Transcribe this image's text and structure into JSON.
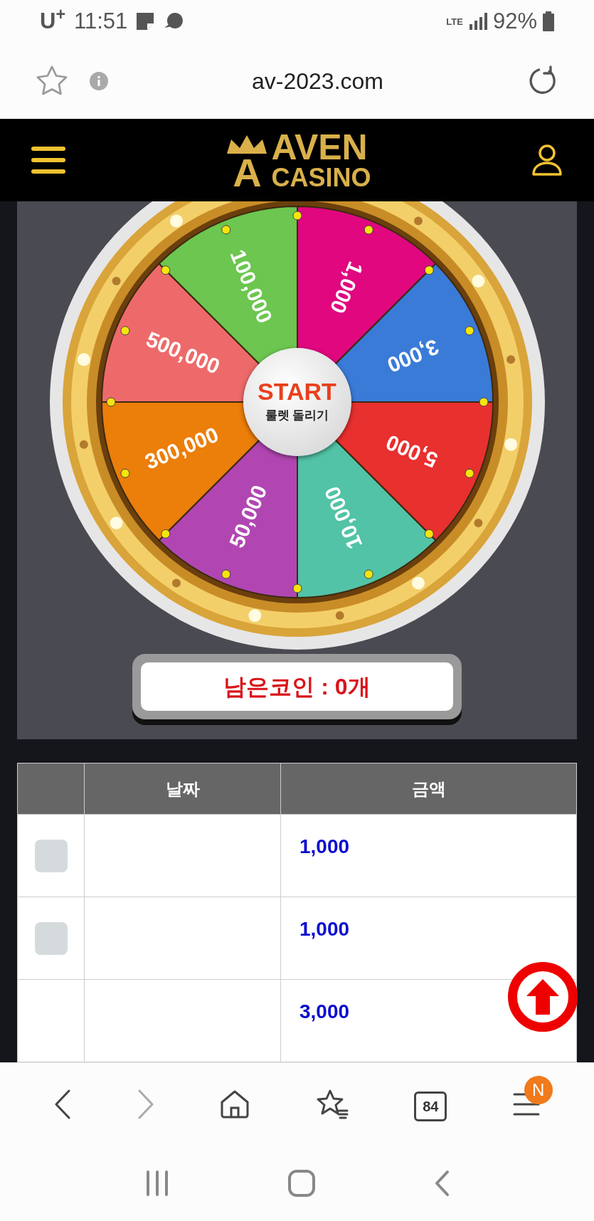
{
  "status_bar": {
    "carrier": "U$^{+}$",
    "time": "11:51",
    "network": "LTE",
    "battery": "92%"
  },
  "browser": {
    "url": "av-2023.com"
  },
  "header": {
    "logo_letter": "A",
    "logo_top": "AVEN",
    "logo_bottom": "CASINO"
  },
  "wheel": {
    "segments": [
      {
        "label": "1,000",
        "color": "#e0077f"
      },
      {
        "label": "3,000",
        "color": "#3a7bd8"
      },
      {
        "label": "5,000",
        "color": "#e8302f"
      },
      {
        "label": "10,000",
        "color": "#52c3a6"
      },
      {
        "label": "50,000",
        "color": "#b146b3"
      },
      {
        "label": "300,000",
        "color": "#ec7e0a"
      },
      {
        "label": "500,000",
        "color": "#ee6a6a"
      },
      {
        "label": "100,000",
        "color": "#6cc64f"
      }
    ],
    "start_label": "START",
    "start_sublabel": "룰렛 돌리기"
  },
  "coins": {
    "text": "남은코인 : 0개"
  },
  "table": {
    "columns": [
      "날짜",
      "금액"
    ],
    "rows": [
      {
        "checked": false,
        "amount": "1,000"
      },
      {
        "checked": false,
        "amount": "1,000"
      },
      {
        "amount": "3,000"
      }
    ]
  },
  "bottom_nav": {
    "tabs_count": "84",
    "menu_badge": "N"
  }
}
